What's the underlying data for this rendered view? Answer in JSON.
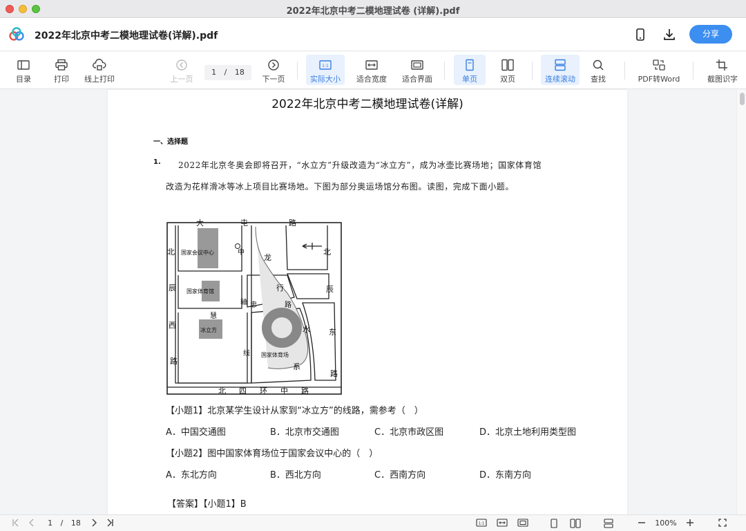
{
  "window": {
    "title": "2022年北京中考二模地理试卷 (详解).pdf"
  },
  "header": {
    "doc_title": "2022年北京中考二模地理试卷(详解).pdf",
    "share_label": "分享"
  },
  "toolbar": {
    "toc": "目录",
    "print": "打印",
    "online_print": "线上打印",
    "prev_page": "上一页",
    "current_page": "1",
    "page_sep": "/",
    "total_pages": "18",
    "next_page": "下一页",
    "actual_size": "实际大小",
    "fit_width": "适合宽度",
    "fit_screen": "适合界面",
    "single_page": "单页",
    "double_page": "双页",
    "continuous_scroll": "连续滚动",
    "find": "查找",
    "pdf_to_word": "PDF转Word",
    "ocr": "截图识字",
    "actual_size_badge": "1:1"
  },
  "document": {
    "title": "2022年北京中考二模地理试卷(详解)",
    "section": "一、选择题",
    "q_number": "1.",
    "para_line1": "2022年北京冬奥会即将召开，“水立方”升级改造为“冰立方”，成为冰壶比赛场地；国家体育馆",
    "para_line2": "改造为花样滑冰等冰上项目比赛场地。下图为部分奥运场馆分布图。读图，完成下面小题。",
    "sub_q1": "【小题1】北京某学生设计从家到“冰立方”的线路，需参考（　）",
    "q1_options": [
      "A．中国交通图",
      "B．北京市交通图",
      "C．北京市政区图",
      "D．北京土地利用类型图"
    ],
    "sub_q2": "【小题2】图中国家体育场位于国家会议中心的（　）",
    "q2_options": [
      "A．东北方向",
      "B．西北方向",
      "C．西南方向",
      "D．东南方向"
    ],
    "answer": "【答案】【小题1】B",
    "map_labels": {
      "top_road": [
        "大",
        "屯",
        "路"
      ],
      "bottom_road": [
        "北",
        "四",
        "环",
        "中",
        "路"
      ],
      "left_road": [
        "北",
        "辰",
        "西",
        "路"
      ],
      "right_road": [
        "北",
        "辰",
        "东",
        "路"
      ],
      "longxing": [
        "龙",
        "行",
        "水",
        "系"
      ],
      "axis": [
        "中",
        "轴",
        "慧",
        "忠",
        "路",
        "线"
      ],
      "conference": "国家会议中心",
      "gymnasium": "国家体育馆",
      "ice_cube": "冰立方",
      "stadium": "国家体育场"
    }
  },
  "statusbar": {
    "current_page": "1",
    "page_sep": "/",
    "total_pages": "18",
    "zoom": "100%",
    "actual_size_badge": "1:1"
  },
  "colors": {
    "accent": "#3c8ef0",
    "active_bg": "#e8f1fd"
  }
}
